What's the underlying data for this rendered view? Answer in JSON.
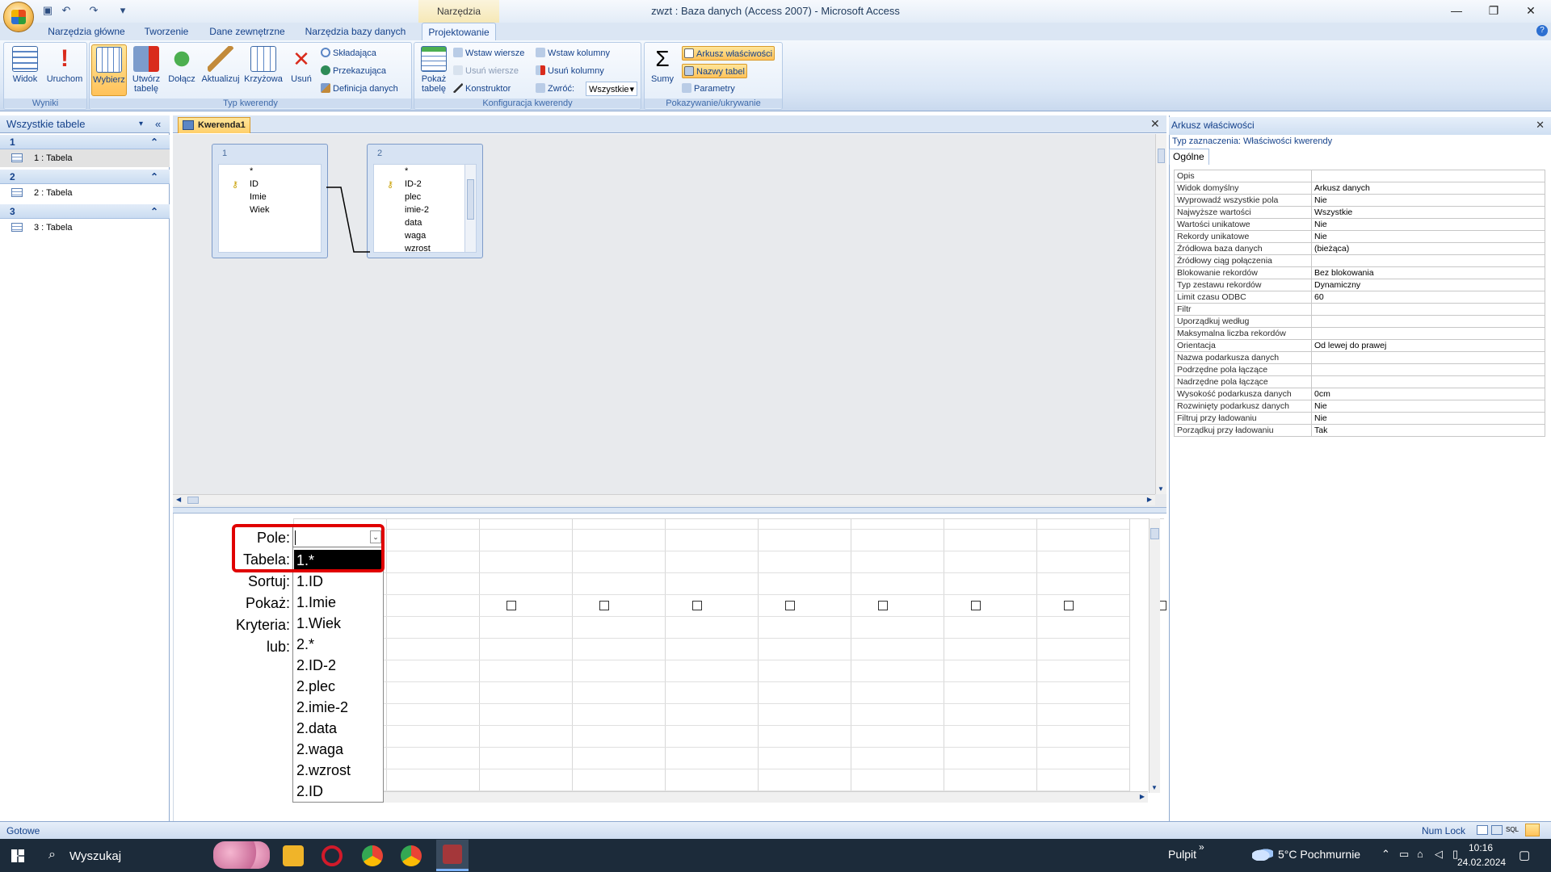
{
  "window": {
    "title": "zwzt : Baza danych (Access 2007) - Microsoft Access",
    "context_tab_title": "Narzędzia kwerend",
    "minimize": "—",
    "restore": "❐",
    "close": "✕",
    "qat_more": "▾"
  },
  "tabs": [
    "Narzędzia główne",
    "Tworzenie",
    "Dane zewnętrzne",
    "Narzędzia bazy danych",
    "Projektowanie"
  ],
  "ribbon": {
    "wyniki": {
      "label": "Wyniki",
      "widok": "Widok",
      "uruchom": "Uruchom"
    },
    "typ": {
      "label": "Typ kwerendy",
      "wybierz": "Wybierz",
      "utworz": "Utwórz tabelę",
      "dolacz": "Dołącz",
      "aktualizuj": "Aktualizuj",
      "krzyzowa": "Krzyżowa",
      "usun": "Usuń",
      "skladajaca": "Składająca",
      "przekazujaca": "Przekazująca",
      "definicja": "Definicja danych"
    },
    "konfig": {
      "label": "Konfiguracja kwerendy",
      "pokaz": "Pokaż tabelę",
      "wstaw_wiersze": "Wstaw wiersze",
      "usun_wiersze": "Usuń wiersze",
      "konstruktor": "Konstruktor",
      "wstaw_kolumny": "Wstaw kolumny",
      "usun_kolumny": "Usuń kolumny",
      "zwroc": "Zwróć:",
      "zwroc_value": "Wszystkie"
    },
    "pokazywanie": {
      "label": "Pokazywanie/ukrywanie",
      "sumy": "Sumy",
      "arkusz": "Arkusz właściwości",
      "nazwy": "Nazwy tabel",
      "parametry": "Parametry"
    }
  },
  "nav": {
    "header": "Wszystkie tabele",
    "groups": [
      {
        "name": "1",
        "item": "1 : Tabela"
      },
      {
        "name": "2",
        "item": "2 : Tabela"
      },
      {
        "name": "3",
        "item": "3 : Tabela"
      }
    ]
  },
  "doc_tab": "Kwerenda1",
  "table1": {
    "title": "1",
    "fields": [
      "*",
      "ID",
      "Imie",
      "Wiek"
    ]
  },
  "table2": {
    "title": "2",
    "fields": [
      "*",
      "ID-2",
      "plec",
      "imie-2",
      "data",
      "waga",
      "wzrost"
    ]
  },
  "grid_labels": [
    "Pole:",
    "Tabela:",
    "Sortuj:",
    "Pokaż:",
    "Kryteria:",
    "lub:"
  ],
  "dropdown_items": [
    "1.*",
    "1.ID",
    "1.Imie",
    "1.Wiek",
    "2.*",
    "2.ID-2",
    "2.plec",
    "2.imie-2",
    "2.data",
    "2.waga",
    "2.wzrost",
    "2.ID"
  ],
  "props": {
    "header": "Arkusz właściwości",
    "selection_type": "Typ zaznaczenia:  Właściwości kwerendy",
    "tab": "Ogólne",
    "rows": [
      [
        "Opis",
        ""
      ],
      [
        "Widok domyślny",
        "Arkusz danych"
      ],
      [
        "Wyprowadź wszystkie pola",
        "Nie"
      ],
      [
        "Najwyższe wartości",
        "Wszystkie"
      ],
      [
        "Wartości unikatowe",
        "Nie"
      ],
      [
        "Rekordy unikatowe",
        "Nie"
      ],
      [
        "Źródłowa baza danych",
        "(bieżąca)"
      ],
      [
        "Źródłowy ciąg połączenia",
        ""
      ],
      [
        "Blokowanie rekordów",
        "Bez blokowania"
      ],
      [
        "Typ zestawu rekordów",
        "Dynamiczny"
      ],
      [
        "Limit czasu ODBC",
        "60"
      ],
      [
        "Filtr",
        ""
      ],
      [
        "Uporządkuj według",
        ""
      ],
      [
        "Maksymalna liczba rekordów",
        ""
      ],
      [
        "Orientacja",
        "Od lewej do prawej"
      ],
      [
        "Nazwa podarkusza danych",
        ""
      ],
      [
        "Podrzędne pola łączące",
        ""
      ],
      [
        "Nadrzędne pola łączące",
        ""
      ],
      [
        "Wysokość podarkusza danych",
        "0cm"
      ],
      [
        "Rozwinięty podarkusz danych",
        "Nie"
      ],
      [
        "Filtruj przy ładowaniu",
        "Nie"
      ],
      [
        "Porządkuj przy ładowaniu",
        "Tak"
      ]
    ]
  },
  "status": {
    "left": "Gotowe",
    "numlock": "Num Lock",
    "sql": "SQL"
  },
  "taskbar": {
    "search": "Wyszukaj",
    "pulpit": "Pulpit",
    "chevron": "»",
    "weather": "5°C  Pochmurnie",
    "time": "10:16",
    "date": "24.02.2024"
  }
}
